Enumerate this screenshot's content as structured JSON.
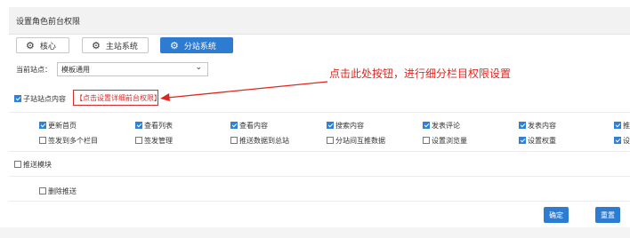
{
  "panel_title": "设置角色前台权限",
  "tabs": [
    {
      "label": "核心",
      "icon": "gears-icon",
      "active": false
    },
    {
      "label": "主站系统",
      "icon": "gears-icon",
      "active": false
    },
    {
      "label": "分站系统",
      "icon": "gears-icon",
      "active": true
    }
  ],
  "site_select": {
    "label": "当前站点：",
    "value": "模板通用"
  },
  "substation_content": {
    "label": "子站站点内容",
    "checked": true,
    "link": "【点击设置详细前台权限】"
  },
  "annotation": {
    "text": "点击此处按钮，进行细分栏目权限设置",
    "color": "#e0261f"
  },
  "permissions_row1": [
    {
      "label": "更新首页",
      "checked": true
    },
    {
      "label": "查看列表",
      "checked": true
    },
    {
      "label": "查看内容",
      "checked": true
    },
    {
      "label": "搜索内容",
      "checked": true
    },
    {
      "label": "发表评论",
      "checked": true
    },
    {
      "label": "发表内容",
      "checked": true
    },
    {
      "label": "推",
      "checked": true
    }
  ],
  "permissions_row2": [
    {
      "label": "签发到多个栏目",
      "checked": false
    },
    {
      "label": "签发管理",
      "checked": false
    },
    {
      "label": "推送数据到总站",
      "checked": false
    },
    {
      "label": "分站间互推数据",
      "checked": false
    },
    {
      "label": "设置浏览量",
      "checked": false
    },
    {
      "label": "设置权重",
      "checked": true
    },
    {
      "label": "设",
      "checked": true
    }
  ],
  "push_module": {
    "label": "推送模块",
    "checked": false
  },
  "delete_push": {
    "label": "删除推送",
    "checked": false
  },
  "buttons": {
    "confirm": "确定",
    "reset": "重置"
  },
  "colors": {
    "accent": "#2e7bd2",
    "highlight": "#d72b2b"
  }
}
